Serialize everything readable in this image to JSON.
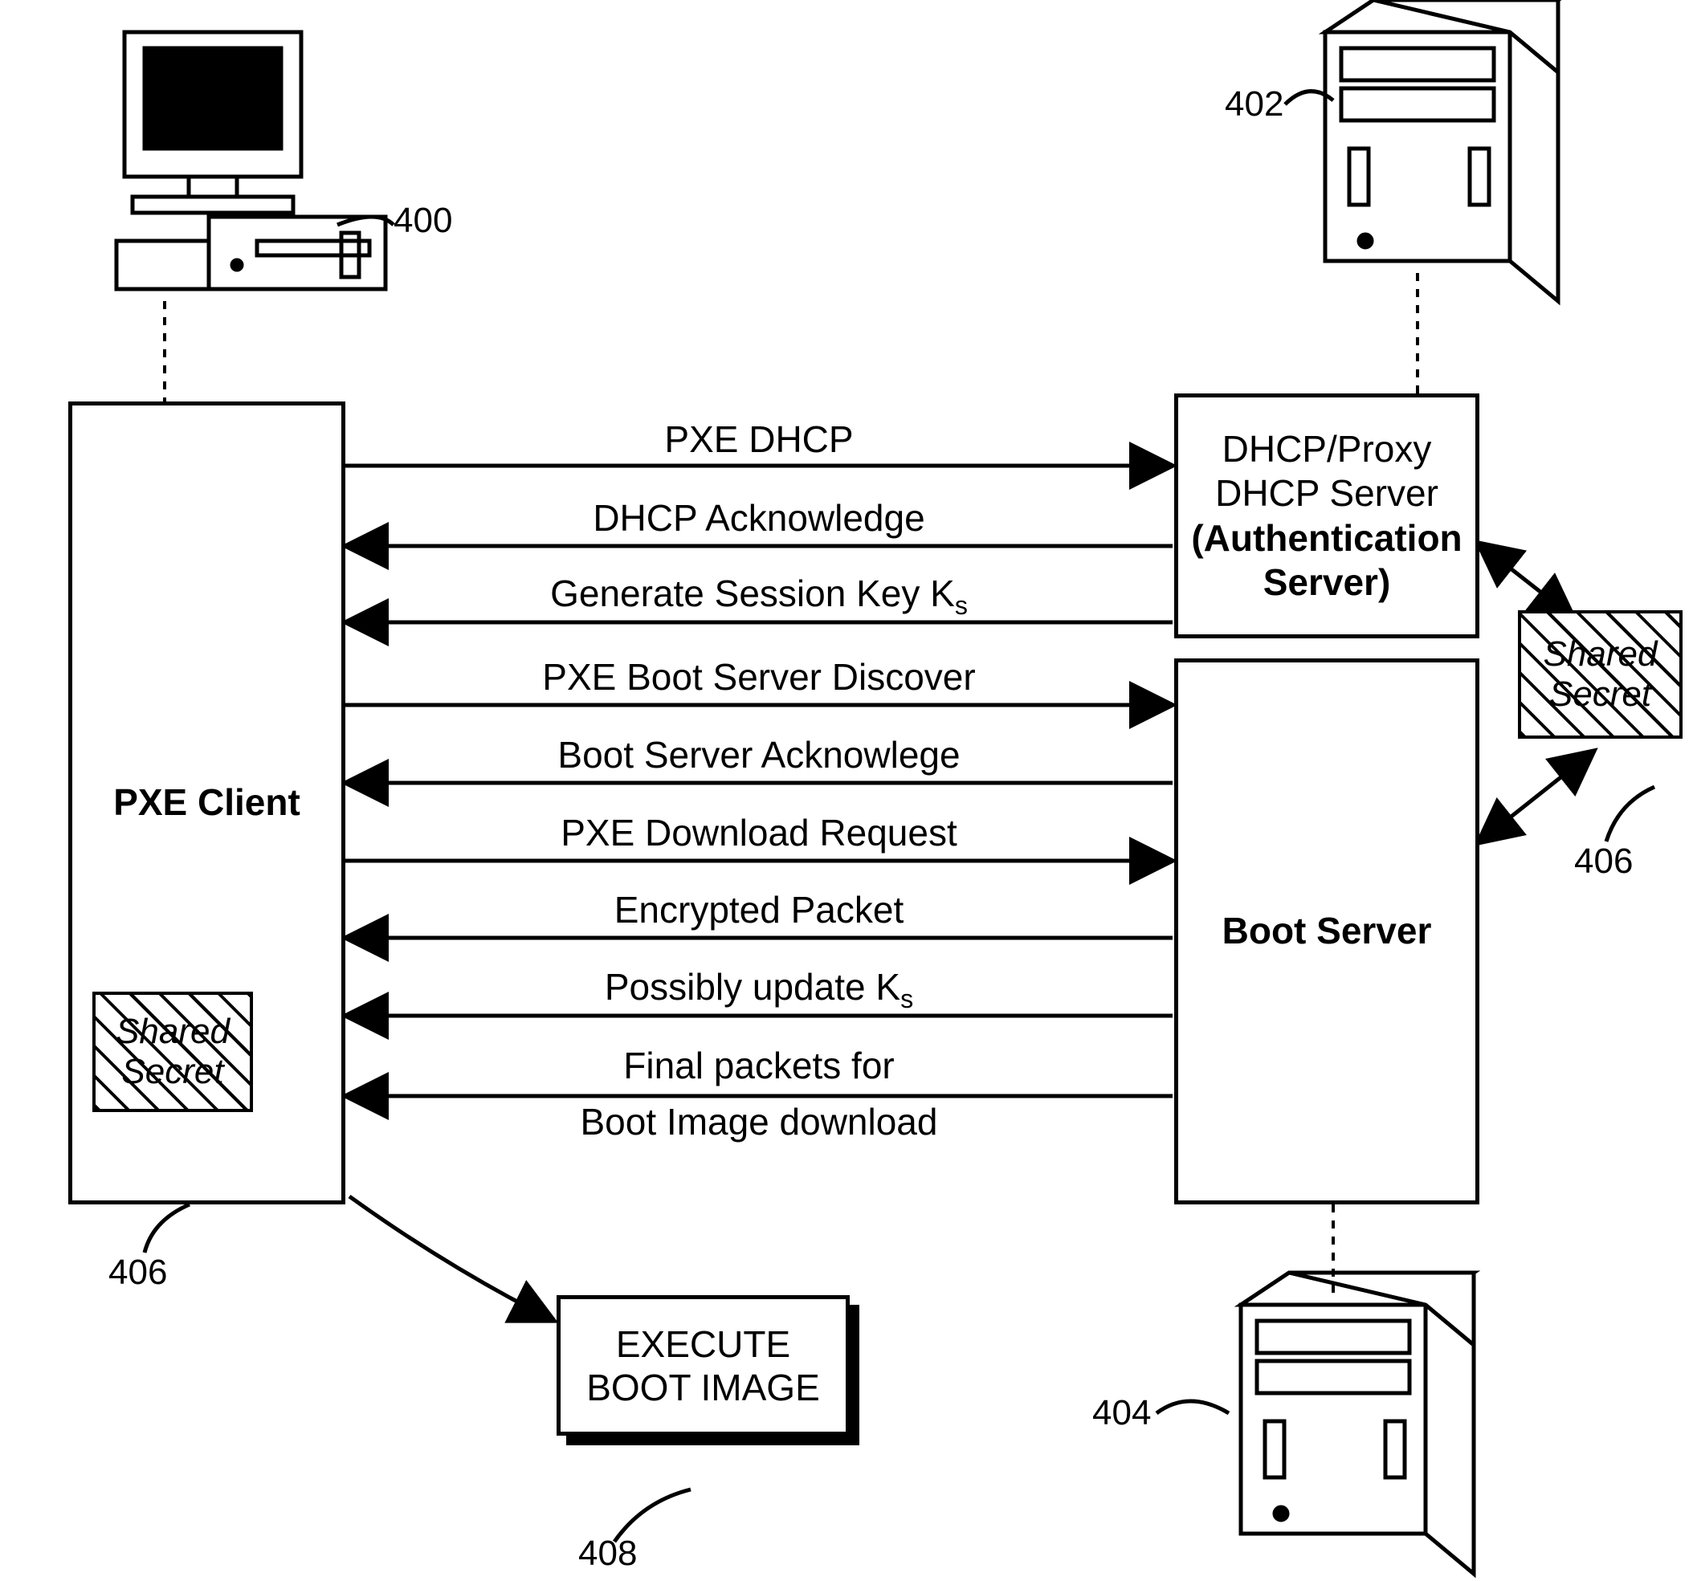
{
  "refs": {
    "client": "400",
    "dhcp": "402",
    "boot": "404",
    "secret_left": "406",
    "secret_right": "406",
    "exec": "408"
  },
  "boxes": {
    "client": "PXE Client",
    "dhcp_line1": "DHCP/Proxy",
    "dhcp_line2": "DHCP Server",
    "dhcp_line3": "(Authentication",
    "dhcp_line4": "Server)",
    "boot": "Boot Server",
    "secret_line1": "Shared",
    "secret_line2": "Secret",
    "exec_line1": "EXECUTE",
    "exec_line2": "BOOT IMAGE"
  },
  "messages": {
    "m1": "PXE DHCP",
    "m2": "DHCP Acknowledge",
    "m3a": "Generate Session Key K",
    "m3b": "s",
    "m4": "PXE Boot Server Discover",
    "m5": "Boot Server Acknowlege",
    "m6": "PXE Download Request",
    "m7": "Encrypted Packet",
    "m8a": "Possibly update K",
    "m8b": "s",
    "m9a": "Final packets for",
    "m9b": "Boot Image download"
  }
}
